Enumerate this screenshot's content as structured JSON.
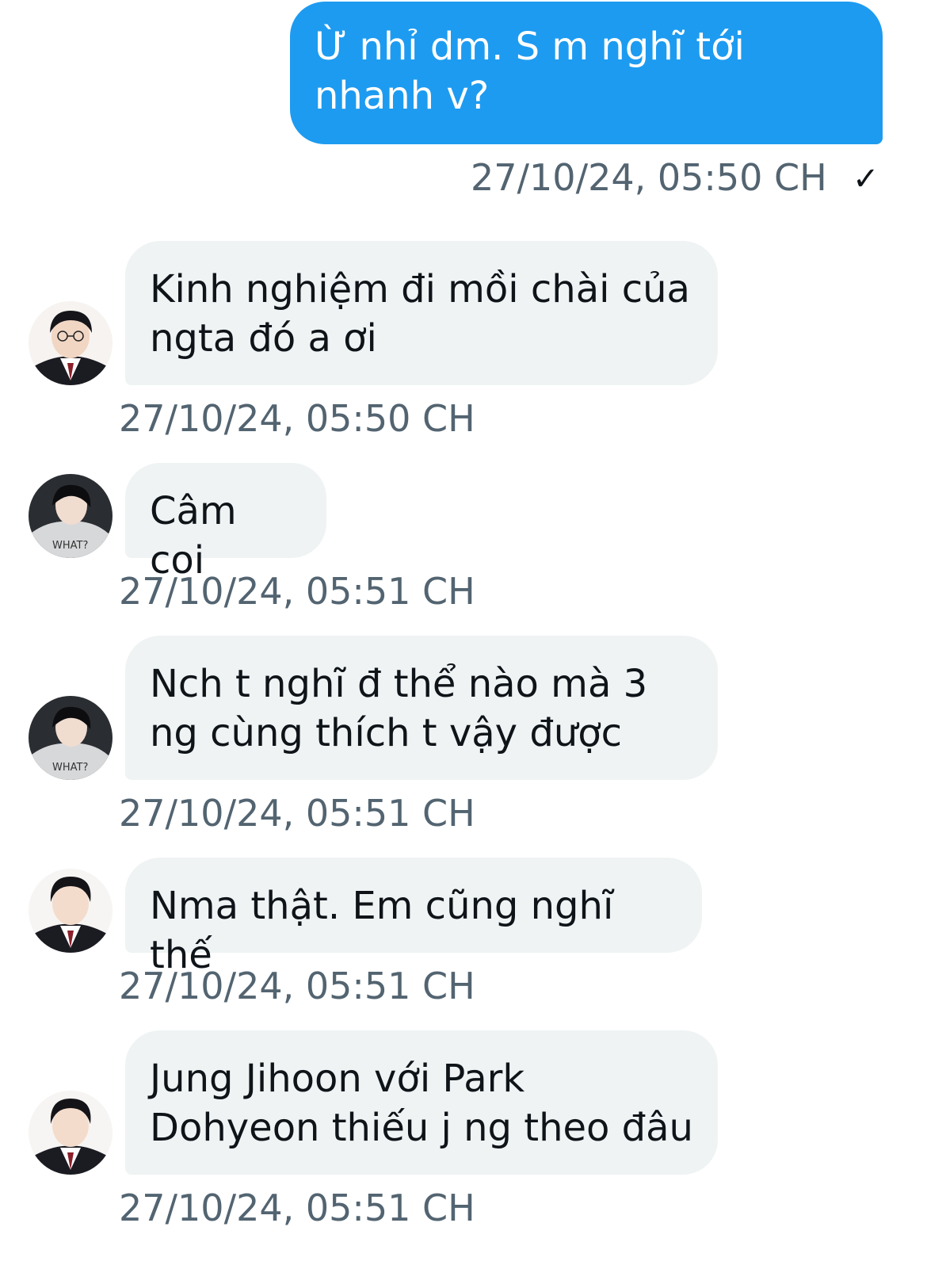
{
  "messages": [
    {
      "side": "sent",
      "text": "Ừ nhỉ dm. S m nghĩ tới\nnhanh v?",
      "timestamp": "27/10/24, 05:50 CH",
      "status_icon": "checkmark-icon"
    },
    {
      "side": "received",
      "avatar": "avatar-glasses-uniform",
      "text": "Kinh nghiệm đi mồi chài của\nngta đó a ơi",
      "timestamp": "27/10/24, 05:50 CH"
    },
    {
      "side": "received",
      "avatar": "avatar-grey-hoodie",
      "text": "Câm coi",
      "timestamp": "27/10/24, 05:51 CH"
    },
    {
      "side": "received",
      "avatar": "avatar-grey-hoodie",
      "text": "Nch t nghĩ đ thể nào mà 3\nng cùng thích t vậy được",
      "timestamp": "27/10/24, 05:51 CH"
    },
    {
      "side": "received",
      "avatar": "avatar-uniform",
      "text": "Nma thật. Em cũng nghĩ thế",
      "timestamp": "27/10/24, 05:51 CH"
    },
    {
      "side": "received",
      "avatar": "avatar-uniform",
      "text": "Jung Jihoon với Park\nDohyeon thiếu j ng theo đâu",
      "timestamp": "27/10/24, 05:51 CH"
    }
  ],
  "colors": {
    "sent_bubble": "#1d9bf0",
    "received_bubble": "#eff3f4",
    "timestamp": "#536471"
  }
}
